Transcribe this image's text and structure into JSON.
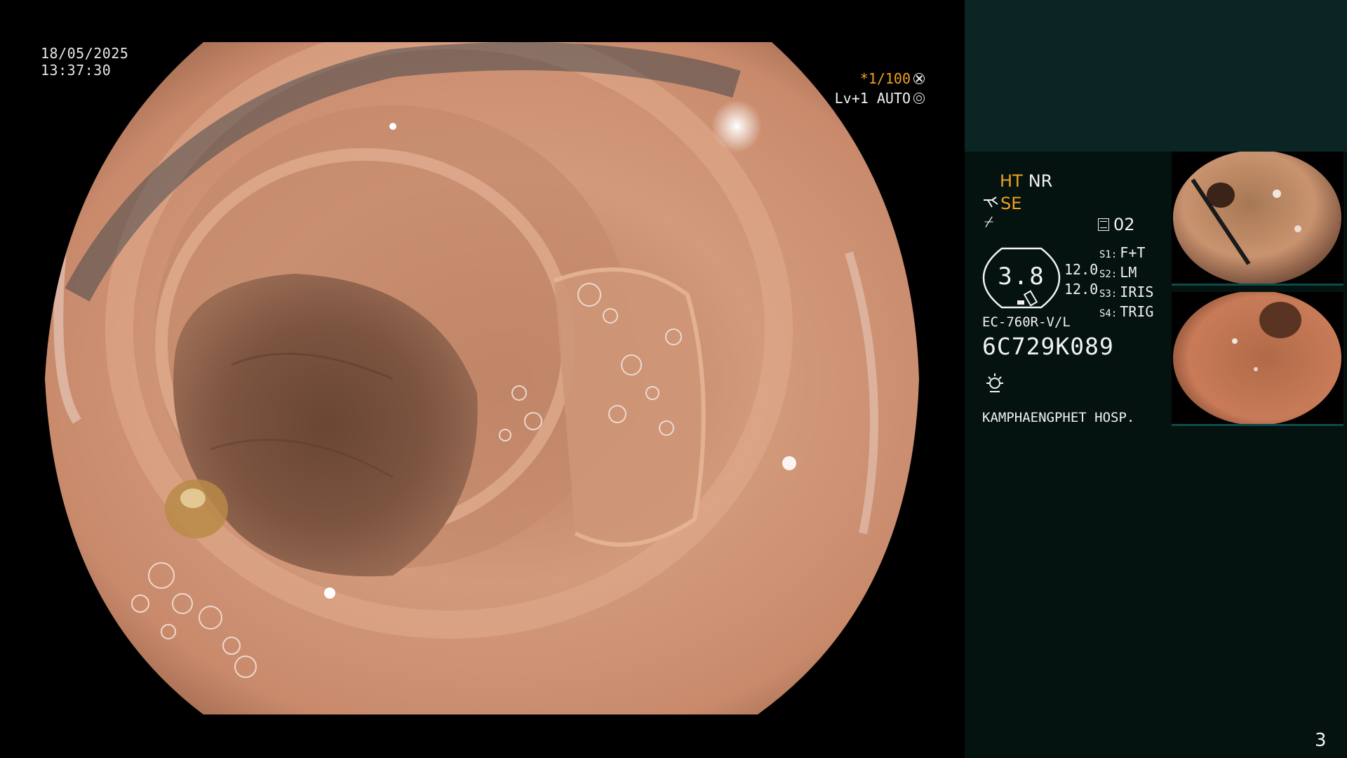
{
  "overlay": {
    "date": "18/05/2025",
    "time": "13:37:30",
    "shutter": "*1/100",
    "level": "Lv+1 AUTO"
  },
  "info_panel": {
    "mode_ht": "HT",
    "mode_nr": "NR",
    "se_label": "SE",
    "flex_glyph": "⌿",
    "channel": "02",
    "gauge_value": "3.8",
    "values": [
      "12.0",
      "12.0"
    ],
    "settings": [
      {
        "key": "S1:",
        "value": "F+T"
      },
      {
        "key": "S2:",
        "value": "LM"
      },
      {
        "key": "S3:",
        "value": "IRIS"
      },
      {
        "key": "S4:",
        "value": "TRIG"
      }
    ],
    "scope_model": "EC-760R-V/L",
    "scope_serial": "6C729K089",
    "hospital": "KAMPHAENGPHET HOSP.",
    "page_number": "3"
  },
  "colors": {
    "accent_orange": "#f0a020",
    "panel_bg": "#041210",
    "panel_header": "#0b2424",
    "text": "#f2f2f2"
  },
  "icons": [
    "shutter-icon",
    "auto-iris-icon",
    "scissors-icon",
    "flexibility-icon",
    "memo-icon",
    "light-source-icon"
  ]
}
